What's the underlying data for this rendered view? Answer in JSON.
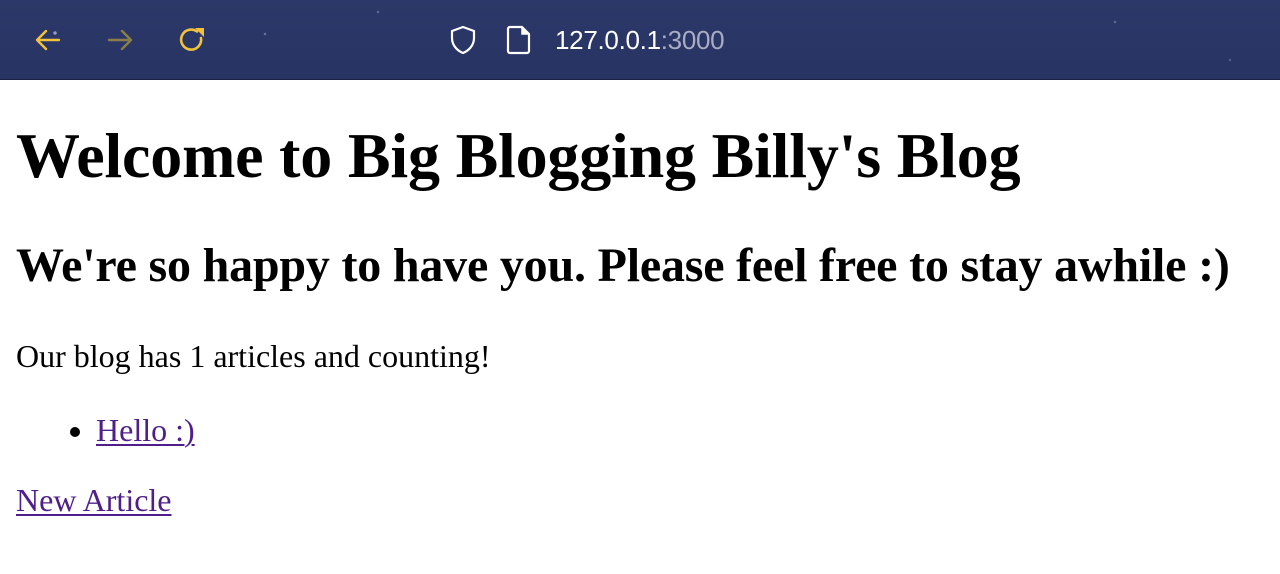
{
  "browser": {
    "url_host": "127.0.0.1",
    "url_port": ":3000",
    "icons": {
      "back": "arrow-left-icon",
      "forward": "arrow-right-icon",
      "reload": "reload-icon",
      "shield": "shield-icon",
      "page": "page-icon"
    },
    "colors": {
      "toolbar_bg": "#2a3662",
      "icon_active": "#f2c23a",
      "icon_disabled": "#8a7d4a"
    }
  },
  "page": {
    "title": "Welcome to Big Blogging Billy's Blog",
    "subtitle": "We're so happy to have you. Please feel free to stay awhile :)",
    "article_count_text": "Our blog has 1 articles and counting!",
    "articles": [
      {
        "title": "Hello :)"
      }
    ],
    "new_article_link": "New Article",
    "colors": {
      "link": "#4f1e8a"
    }
  }
}
